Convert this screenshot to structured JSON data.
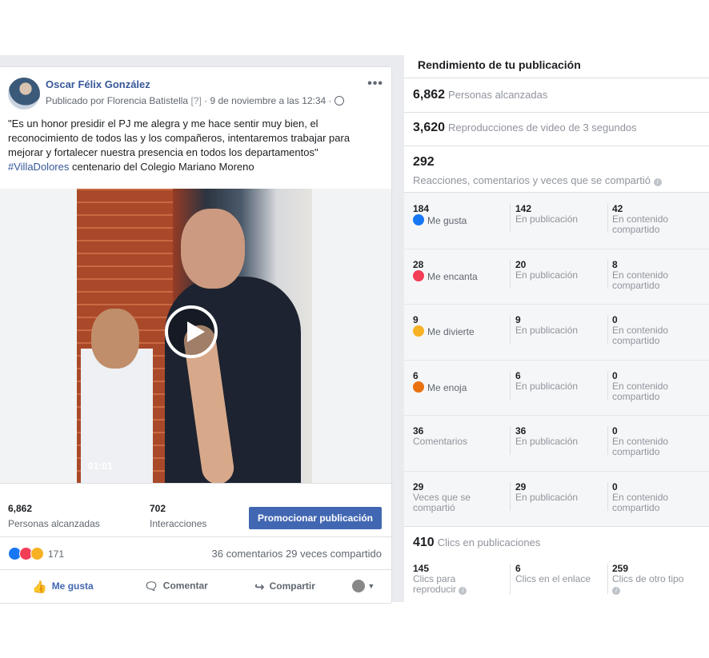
{
  "post": {
    "author": "Oscar Félix González",
    "meta_prefix": "Publicado por Florencia Batistella",
    "meta_q": "[?]",
    "meta_date": " · 9 de noviembre a las 12:34 · ",
    "more_icon": "more-horizontal-icon",
    "text": "\"Es un honor presidir el PJ me alegra y me hace sentir muy bien, el reconocimiento de todos las y los compañeros, intentaremos trabajar para mejorar y fortalecer nuestra presencia en todos los departamentos\"",
    "hashtag": "#VillaDolores",
    "text2": " centenario del Colegio Mariano Moreno",
    "video_time": "01:01",
    "people_reached_num": "6,862",
    "people_reached_lbl": "Personas alcanzadas",
    "interactions_num": "702",
    "interactions_lbl": "Interacciones",
    "promote_label": "Promocionar publicación",
    "reactions_count": "171",
    "comments_shares": "36 comentarios  29 veces compartido",
    "actions": {
      "like": "Me gusta",
      "comment": "Comentar",
      "share": "Compartir"
    },
    "colors": {
      "brand": "#4267b2",
      "link": "#365899"
    }
  },
  "insights": {
    "title": "Rendimiento de tu publicación",
    "reached_num": "6,862",
    "reached_lbl": "Personas alcanzadas",
    "views_num": "3,620",
    "views_lbl": "Reproducciones de video de 3 segundos",
    "engagement_num": "292",
    "engagement_lbl": "Reacciones, comentarios y veces que se compartió",
    "rows": [
      {
        "total": "184",
        "label": "Me gusta",
        "icon": "like-icon",
        "on_post": "142",
        "on_shares": "42"
      },
      {
        "total": "28",
        "label": "Me encanta",
        "icon": "love-icon",
        "on_post": "20",
        "on_shares": "8"
      },
      {
        "total": "9",
        "label": "Me divierte",
        "icon": "haha-icon",
        "on_post": "9",
        "on_shares": "0"
      },
      {
        "total": "6",
        "label": "Me enoja",
        "icon": "angry-icon",
        "on_post": "6",
        "on_shares": "0"
      },
      {
        "total": "36",
        "label": "Comentarios",
        "icon": "",
        "on_post": "36",
        "on_shares": "0"
      },
      {
        "total": "29",
        "label": "Veces que se compartió",
        "icon": "",
        "on_post": "29",
        "on_shares": "0"
      }
    ],
    "on_post_lbl": "En publicación",
    "on_shares_lbl": "En contenido compartido",
    "clicks_num": "410",
    "clicks_lbl": "Clics en publicaciones",
    "click_play_num": "145",
    "click_play_lbl": "Clics para reproducir",
    "click_link_num": "6",
    "click_link_lbl": "Clics en el enlace",
    "click_other_num": "259",
    "click_other_lbl": "Clics de otro tipo"
  }
}
